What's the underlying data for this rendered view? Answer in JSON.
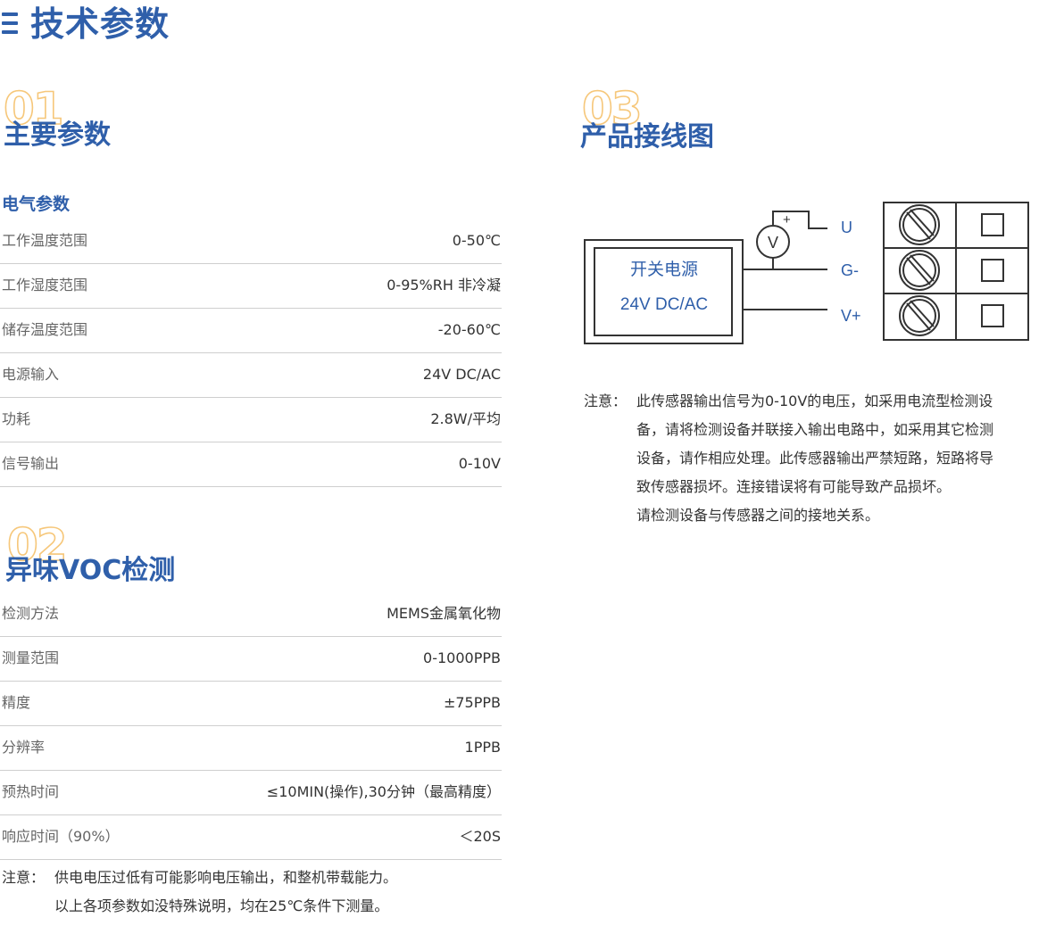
{
  "page_title": "技术参数",
  "section1": {
    "num": "01",
    "title": "主要参数",
    "subtitle": "电气参数",
    "rows": [
      {
        "label": "工作温度范围",
        "value": "0-50℃"
      },
      {
        "label": "工作湿度范围",
        "value": "0-95%RH 非冷凝"
      },
      {
        "label": "储存温度范围",
        "value": "-20-60℃"
      },
      {
        "label": "电源输入",
        "value": "24V DC/AC"
      },
      {
        "label": "功耗",
        "value": "2.8W/平均"
      },
      {
        "label": "信号输出",
        "value": "0-10V"
      }
    ]
  },
  "section2": {
    "num": "02",
    "title": "异味VOC检测",
    "rows": [
      {
        "label": "检测方法",
        "value": "MEMS金属氧化物"
      },
      {
        "label": "测量范围",
        "value": "0-1000PPB"
      },
      {
        "label": "精度",
        "value": "±75PPB"
      },
      {
        "label": "分辨率",
        "value": "1PPB"
      },
      {
        "label": "预热时间",
        "value": "≤10MIN(操作),30分钟（最高精度）"
      },
      {
        "label": "响应时间（90%）",
        "value": "＜20S"
      }
    ],
    "note_label": "注意：",
    "note_lines": [
      "供电电压过低有可能影响电压输出，和整机带载能力。",
      "以上各项参数如没特殊说明，均在25℃条件下测量。"
    ]
  },
  "section3": {
    "num": "03",
    "title": "产品接线图",
    "diagram": {
      "box_line1": "开关电源",
      "box_line2": "24V DC/AC",
      "meter_label": "V",
      "plus_label": "+",
      "terminals": [
        "U",
        "G-",
        "V+"
      ]
    },
    "note_label": "注意：",
    "note_lines": [
      "此传感器输出信号为0-10V的电压，如采用电流型检测设",
      "备，请将检测设备并联接入输出电路中，如采用其它检测",
      "设备，请作相应处理。此传感器输出严禁短路，短路将导",
      "致传感器损坏。连接错误将有可能导致产品损坏。",
      "请检测设备与传感器之间的接地关系。"
    ]
  },
  "colors": {
    "accent": "#2f5faa",
    "number_outline": "#f6c77a",
    "divider": "#cfcfcf"
  }
}
